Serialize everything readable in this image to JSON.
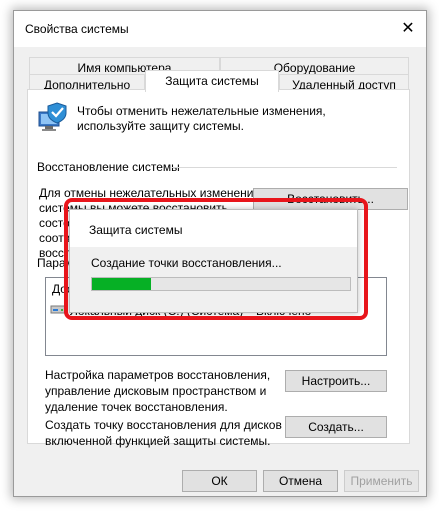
{
  "window": {
    "title": "Свойства системы",
    "close_glyph": "✕"
  },
  "tabs": {
    "row1": [
      "Имя компьютера",
      "Оборудование"
    ],
    "row2": [
      "Дополнительно",
      "Защита системы",
      "Удаленный доступ"
    ],
    "active": "Защита системы"
  },
  "intro": "Чтобы отменить нежелательные изменения, используйте защиту системы.",
  "restore": {
    "heading": "Восстановление системы",
    "text_line1": "Для отмены нежелательных изменений",
    "text_line2": "системы вы можете восстановить",
    "text_line3": "состо",
    "text_line4": "соотве",
    "text_line5": "восста",
    "button": "Восстановить..."
  },
  "params": {
    "heading_partial": "Парамет",
    "list_header": "Дост",
    "drive_name": "Локальный диск (C:) (Система)",
    "drive_status": "Включено"
  },
  "configure": {
    "text_line1": "Настройка параметров восстановления,",
    "text_line2": "управление дисковым пространством и",
    "text_line3": "удаление точек восстановления.",
    "button": "Настроить..."
  },
  "create": {
    "text_line1": "Создать точку восстановления для дисков с",
    "text_line2": "включенной функцией защиты системы.",
    "button": "Создать..."
  },
  "footer": {
    "ok": "ОК",
    "cancel": "Отмена",
    "apply": "Применить"
  },
  "dialog": {
    "title": "Защита системы",
    "message": "Создание точки восстановления...",
    "progress_fraction": 0.23
  },
  "colors": {
    "progress": "#06b025",
    "highlight": "#e8151b"
  },
  "icons": [
    "shield-computer-icon",
    "drive-icon",
    "close-icon"
  ]
}
